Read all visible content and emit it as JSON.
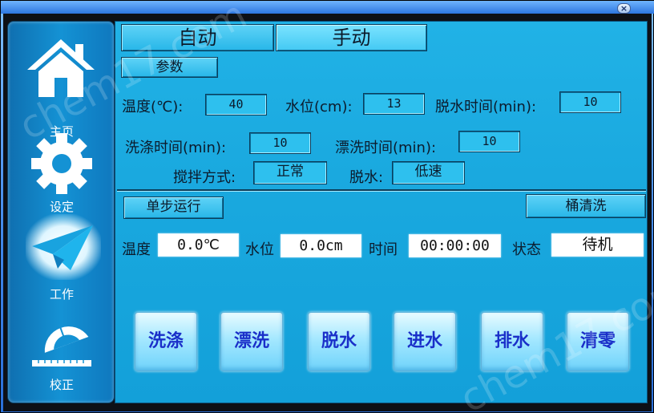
{
  "window": {
    "close_glyph": "×"
  },
  "sidebar": {
    "items": [
      {
        "label": "主页",
        "icon": "home-icon"
      },
      {
        "label": "设定",
        "icon": "gear-icon"
      },
      {
        "label": "工作",
        "icon": "paper-plane-icon",
        "active": true
      },
      {
        "label": "校正",
        "icon": "protractor-ruler-icon"
      }
    ]
  },
  "mode_tabs": [
    {
      "label": "自动"
    },
    {
      "label": "手动",
      "active": true
    }
  ],
  "params_button": "参数",
  "settings": {
    "temperature": {
      "label": "温度(℃):",
      "value": "40"
    },
    "water_level": {
      "label": "水位(cm):",
      "value": "13"
    },
    "spin_time": {
      "label": "脱水时间(min):",
      "value": "10"
    },
    "wash_time": {
      "label": "洗涤时间(min):",
      "value": "10"
    },
    "rinse_time": {
      "label": "漂洗时间(min):",
      "value": "10"
    },
    "stir_mode": {
      "label": "搅拌方式:",
      "value": "正常"
    },
    "spin": {
      "label": "脱水:",
      "value": "低速"
    }
  },
  "single_step_button": "单步运行",
  "drum_clean_button": "桶清洗",
  "status": {
    "temperature": {
      "label": "温度",
      "value": "0.0℃"
    },
    "water_level": {
      "label": "水位",
      "value": "0.0cm"
    },
    "time": {
      "label": "时间",
      "value": "00:00:00"
    },
    "state": {
      "label": "状态",
      "value": "待机"
    }
  },
  "actions": [
    {
      "label": "洗涤"
    },
    {
      "label": "漂洗"
    },
    {
      "label": "脱水"
    },
    {
      "label": "进水"
    },
    {
      "label": "排水"
    },
    {
      "label": "清零"
    }
  ],
  "watermark": "chem17.com",
  "colors": {
    "panel": "#1aa9df",
    "action_text": "#1a2fc9",
    "sidebar": "#1492d4"
  }
}
